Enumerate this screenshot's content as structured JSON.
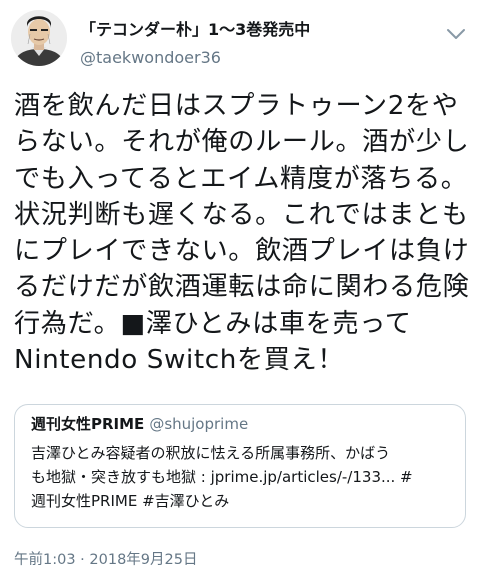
{
  "author": {
    "name": "「テコンダー朴」1〜3巻発売中",
    "handle": "@taekwondoer36",
    "avatar_icon": "avatar-illustration-icon",
    "menu_icon": "chevron-down-icon"
  },
  "tweet": {
    "text": "酒を飲んだ日はスプラトゥーン2をや\nらない。それが俺のルール。酒が少し\nでも入ってるとエイム精度が落ちる。\n状況判断も遅くなる。これではまとも\nにプレイできない。飲酒プレイは負け\nるだけだが飲酒運転は命に関わる危険\n行為だ。■澤ひとみは車を売って\nNintendo Switchを買え！"
  },
  "quoted": {
    "name": "週刊女性PRIME",
    "handle": "@shujoprime",
    "text": "吉澤ひとみ容疑者の釈放に怯える所属事務所、かばう\nも地獄・突き放すも地獄 : jprime.jp/articles/-/133... #\n週刊女性PRIME #吉澤ひとみ"
  },
  "timestamp": "午前1:03 · 2018年9月25日",
  "colors": {
    "text": "#14171a",
    "secondary": "#657786",
    "border": "#ccd6dd",
    "background": "#ffffff"
  }
}
